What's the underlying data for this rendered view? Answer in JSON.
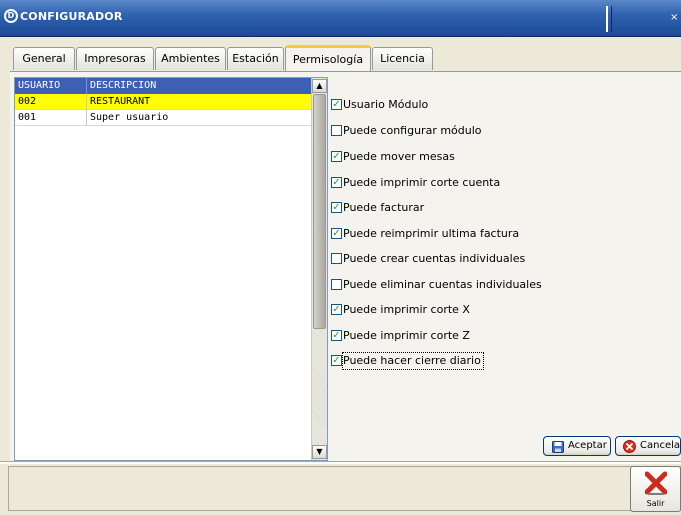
{
  "window": {
    "title": "CONFIGURADOR",
    "close_glyph": "×"
  },
  "tabs": [
    {
      "label": "General"
    },
    {
      "label": "Impresoras"
    },
    {
      "label": "Ambientes"
    },
    {
      "label": "Estación"
    },
    {
      "label": "Permisología",
      "active": true
    },
    {
      "label": "Licencia"
    }
  ],
  "users_table": {
    "columns": [
      "USUARIO",
      "DESCRIPCION"
    ],
    "rows": [
      {
        "usuario": "002",
        "descripcion": "RESTAURANT",
        "selected": true
      },
      {
        "usuario": "001",
        "descripcion": "Super usuario",
        "selected": false
      }
    ]
  },
  "permissions": [
    {
      "label": "Usuario Módulo",
      "checked": true
    },
    {
      "label": "Puede configurar módulo",
      "checked": false
    },
    {
      "label": "Puede mover mesas",
      "checked": true
    },
    {
      "label": "Puede imprimir corte cuenta",
      "checked": true
    },
    {
      "label": "Puede facturar",
      "checked": true
    },
    {
      "label": "Puede reimprimir ultima factura",
      "checked": true
    },
    {
      "label": "Puede crear cuentas individuales",
      "checked": false
    },
    {
      "label": "Puede eliminar cuentas individuales",
      "checked": false
    },
    {
      "label": "Puede imprimir corte X",
      "checked": true
    },
    {
      "label": "Puede imprimir corte Z",
      "checked": true
    },
    {
      "label": "Puede hacer cierre diario",
      "checked": true,
      "focused": true
    }
  ],
  "actions": {
    "accept_label": "Aceptar",
    "cancel_label": "Cancelar",
    "exit_label": "Salir"
  },
  "icons": {
    "accept": "save-icon",
    "cancel": "cancel-icon",
    "exit": "exit-x-icon"
  },
  "colors": {
    "title_bar": "#2f62b0",
    "selected_row": "#ffff00",
    "header_row": "#3d5fb5",
    "active_tab_accent": "#ffc83c",
    "check_mark": "#21a121",
    "cancel_icon": "#d9301f",
    "exit_icon": "#cc2a1a"
  }
}
